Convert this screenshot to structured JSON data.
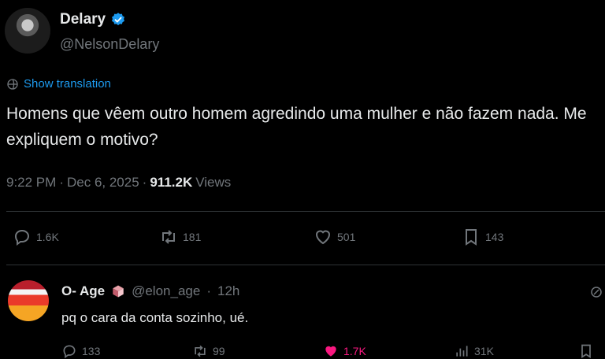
{
  "tweet": {
    "display_name": "Delary",
    "handle": "@NelsonDelary",
    "translate_label": "Show translation",
    "text": "Homens que vêem outro homem agredindo uma mulher e não fazem nada. Me expliquem o motivo?",
    "time": "9:22 PM",
    "date": "Dec 6, 2025",
    "views_count": "911.2K",
    "views_label": "Views",
    "replies": "1.6K",
    "retweets": "181",
    "likes": "501",
    "bookmarks": "143"
  },
  "reply": {
    "display_name": "O- Age",
    "handle": "@elon_age",
    "time": "12h",
    "text": "pq o cara da conta sozinho, ué.",
    "replies": "133",
    "retweets": "99",
    "likes": "1.7K",
    "views": "31K"
  },
  "colors": {
    "background": "#000000",
    "text": "#e7e9ea",
    "muted": "#71767b",
    "accent": "#1d9bf0",
    "like": "#f91880",
    "divider": "#2f3336"
  },
  "icons": {
    "verified": "verified-badge-icon",
    "translate": "globe-icon",
    "reply": "reply-icon",
    "retweet": "retweet-icon",
    "like": "heart-icon",
    "bookmark": "bookmark-icon",
    "views": "views-chart-icon",
    "more": "more-icon"
  }
}
